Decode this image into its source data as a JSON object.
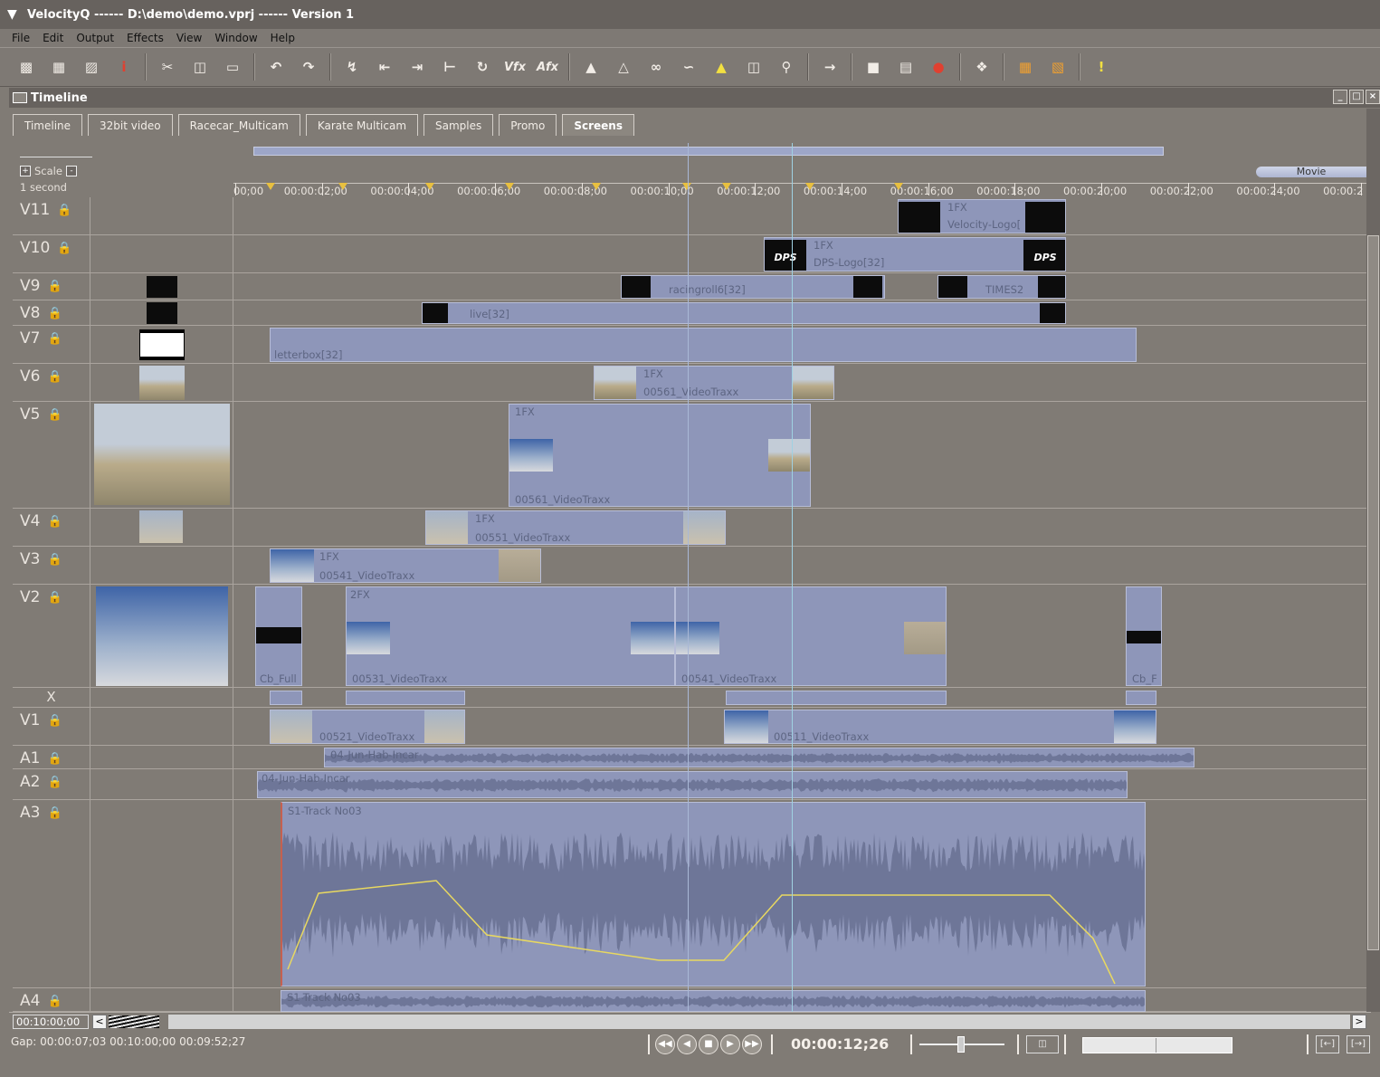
{
  "window": {
    "title": "VelocityQ ------ D:\\demo\\demo.vprj ------ Version 1"
  },
  "menu": [
    "File",
    "Edit",
    "Output",
    "Effects",
    "View",
    "Window",
    "Help"
  ],
  "toolbar": {
    "vfx_label": "Vfx",
    "afx_label": "Afx",
    "alert_label": "!"
  },
  "panel": {
    "title": "Timeline"
  },
  "tabs": [
    "Timeline",
    "32bit video",
    "Racecar_Multicam",
    "Karate Multicam",
    "Samples",
    "Promo",
    "Screens"
  ],
  "active_tab": "Screens",
  "scale": {
    "label": "Scale",
    "unit": "1 second"
  },
  "ruler": {
    "movie_label": "Movie",
    "ticks": [
      "00;00",
      "00:00:02;00",
      "00:00:04;00",
      "00:00:06;00",
      "00:00:08;00",
      "00:00:10;00",
      "00:00:12;00",
      "00:00:14;00",
      "00:00:16;00",
      "00:00:18;00",
      "00:00:20;00",
      "00:00:22;00",
      "00:00:24;00",
      "00:00:2"
    ]
  },
  "tracks": {
    "v11": {
      "name": "V11",
      "fx": "1FX",
      "clip": "Velocity-Logo["
    },
    "v10": {
      "name": "V10",
      "fx": "1FX",
      "clip": "DPS-Logo[32]",
      "logo": "DPS"
    },
    "v9": {
      "name": "V9",
      "clip_a": "racingroll6[32]",
      "clip_b": "TIMES2"
    },
    "v8": {
      "name": "V8",
      "clip": "live[32]"
    },
    "v7": {
      "name": "V7",
      "clip": "letterbox[32]"
    },
    "v6": {
      "name": "V6",
      "fx": "1FX",
      "clip": "00561_VideoTraxx"
    },
    "v5": {
      "name": "V5",
      "fx": "1FX",
      "clip": "00561_VideoTraxx"
    },
    "v4": {
      "name": "V4",
      "fx": "1FX",
      "clip": "00551_VideoTraxx"
    },
    "v3": {
      "name": "V3",
      "fx": "1FX",
      "clip": "00541_VideoTraxx"
    },
    "v2": {
      "name": "V2",
      "fx": "2FX",
      "clip_a": "Cb_Full",
      "clip_b": "00531_VideoTraxx",
      "clip_c": "00541_VideoTraxx",
      "clip_d": "Cb_F"
    },
    "x": {
      "name": "X"
    },
    "v1": {
      "name": "V1",
      "clip_a": "00521_VideoTraxx",
      "clip_b": "00511_VideoTraxx"
    },
    "a1": {
      "name": "A1",
      "clip": "04-Jun-Hab-Incar"
    },
    "a2": {
      "name": "A2",
      "clip": "04-Jun-Hab-Incar"
    },
    "a3": {
      "name": "A3",
      "clip": "S1-Track No03"
    },
    "a4": {
      "name": "A4",
      "clip": "S1-Track No03"
    }
  },
  "hscroll": {
    "timecode": "00:10:00;00"
  },
  "status": {
    "gap": "Gap: 00:00:07;03  00:10:00;00   00:09:52;27",
    "timecode": "00:00:12;26"
  },
  "colors": {
    "background": "#807b75",
    "clip": "#8e96b9",
    "title_bar": "#67625e"
  }
}
